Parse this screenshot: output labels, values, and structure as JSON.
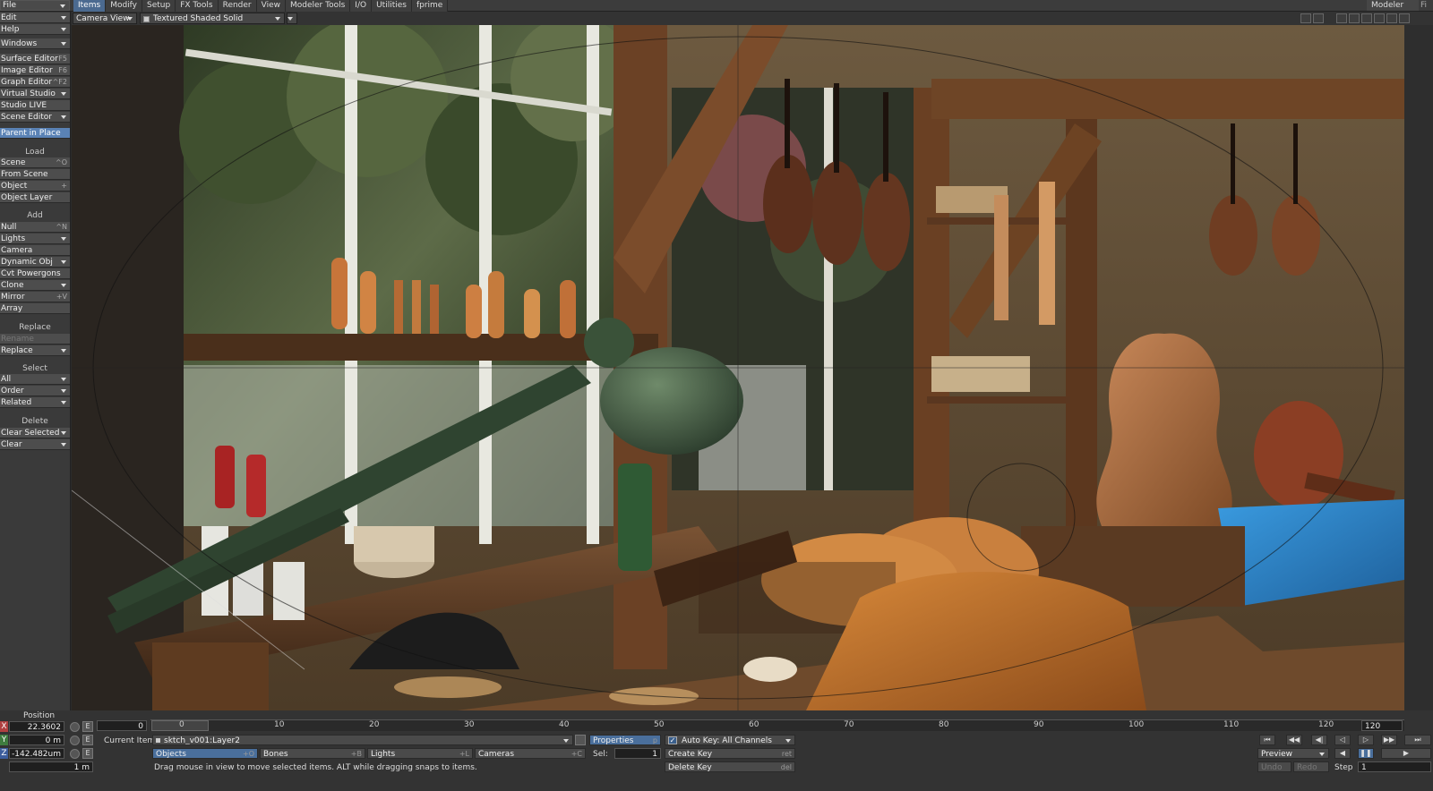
{
  "menu": {
    "file": "File",
    "right_label": "Modeler",
    "right_extra": "Fi"
  },
  "tabs": [
    "Items",
    "Modify",
    "Setup",
    "FX Tools",
    "Render",
    "View",
    "Modeler Tools",
    "I/O",
    "Utilities",
    "fprime"
  ],
  "active_tab": "Items",
  "sidebar": {
    "edit": "Edit",
    "help": "Help",
    "windows": "Windows",
    "surface_editor": {
      "label": "Surface Editor",
      "shortcut": "F5"
    },
    "image_editor": {
      "label": "Image Editor",
      "shortcut": "F6"
    },
    "graph_editor": {
      "label": "Graph Editor",
      "shortcut": "^F2"
    },
    "virtual_studio": "Virtual Studio",
    "studio_live": "Studio LIVE",
    "scene_editor": "Scene Editor",
    "parent_in_place": "Parent in Place",
    "load_header": "Load",
    "scene": {
      "label": "Scene",
      "shortcut": "^O"
    },
    "from_scene": "From Scene",
    "object": {
      "label": "Object",
      "shortcut": "+"
    },
    "object_layer": "Object Layer",
    "add_header": "Add",
    "null": {
      "label": "Null",
      "shortcut": "^N"
    },
    "lights": "Lights",
    "camera": "Camera",
    "dynamic_obj": "Dynamic Obj",
    "cvt_powergons": "Cvt Powergons",
    "clone": "Clone",
    "mirror": {
      "label": "Mirror",
      "shortcut": "+V"
    },
    "array": "Array",
    "replace_header": "Replace",
    "rename": "Rename",
    "replace": "Replace",
    "select_header": "Select",
    "all": "All",
    "order": "Order",
    "related": "Related",
    "delete_header": "Delete",
    "clear_selected": "Clear Selected",
    "clear": "Clear"
  },
  "viewport": {
    "view_mode": "Camera View",
    "render_mode": "Textured Shaded Solid"
  },
  "position": {
    "title": "Position",
    "x_axis": "X",
    "y_axis": "Y",
    "z_axis": "Z",
    "x": "22.3602 mm",
    "y": "0 m",
    "z": "-142.482um",
    "grid": "1 m",
    "e_label": "E"
  },
  "timeline": {
    "start": "0",
    "end": "120",
    "current_frame": 0,
    "ticks": [
      "0",
      "10",
      "20",
      "30",
      "40",
      "50",
      "60",
      "70",
      "80",
      "90",
      "100",
      "110",
      "120"
    ]
  },
  "current_item": {
    "label": "Current Item",
    "value": "sktch_v001:Layer2"
  },
  "item_types": [
    {
      "label": "Objects",
      "shortcut": "+O"
    },
    {
      "label": "Bones",
      "shortcut": "+B"
    },
    {
      "label": "Lights",
      "shortcut": "+L"
    },
    {
      "label": "Cameras",
      "shortcut": "+C"
    }
  ],
  "properties": {
    "label": "Properties",
    "shortcut": "p"
  },
  "sel": {
    "label": "Sel:",
    "value": "1"
  },
  "autokey": "Auto Key: All Channels",
  "create_key": {
    "label": "Create Key",
    "shortcut": "ret"
  },
  "delete_key": {
    "label": "Delete Key",
    "shortcut": "del"
  },
  "status": "Drag mouse in view to move selected items. ALT while dragging snaps to items.",
  "preview": "Preview",
  "undo": "Undo",
  "redo": "Redo",
  "step_label": "Step",
  "step_value": "1",
  "transport_icons": [
    "first-frame-icon",
    "prev-key-icon",
    "step-back-icon",
    "play-back-icon",
    "play-forward-icon",
    "next-key-icon",
    "last-frame-icon"
  ]
}
